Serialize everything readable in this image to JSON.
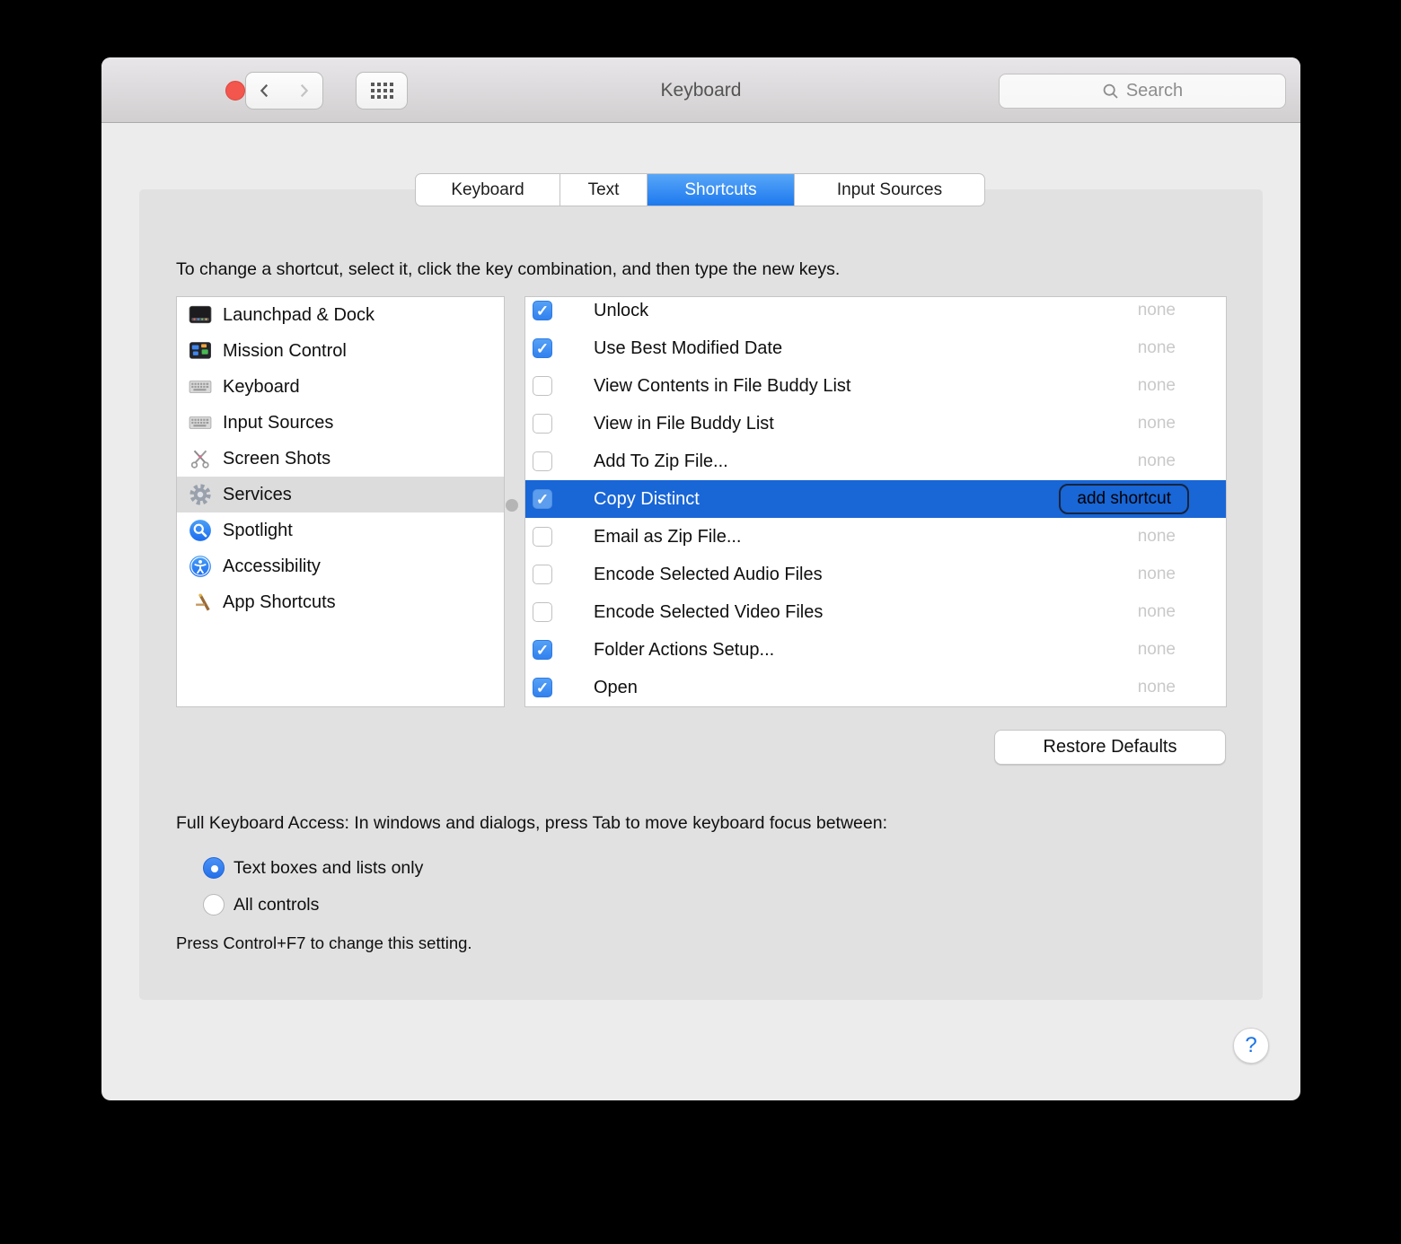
{
  "titlebar": {
    "title": "Keyboard",
    "search": {
      "placeholder": "Search"
    }
  },
  "tabs": {
    "items": [
      {
        "label": "Keyboard",
        "selected": false
      },
      {
        "label": "Text",
        "selected": false
      },
      {
        "label": "Shortcuts",
        "selected": true
      },
      {
        "label": "Input Sources",
        "selected": false
      }
    ]
  },
  "instruction": "To change a shortcut, select it, click the key combination, and then type the new keys.",
  "sidebar": {
    "items": [
      {
        "label": "Launchpad & Dock",
        "icon": "launchpad-dock-icon",
        "selected": false
      },
      {
        "label": "Mission Control",
        "icon": "mission-control-icon",
        "selected": false
      },
      {
        "label": "Keyboard",
        "icon": "keyboard-icon",
        "selected": false
      },
      {
        "label": "Input Sources",
        "icon": "input-sources-icon",
        "selected": false
      },
      {
        "label": "Screen Shots",
        "icon": "screen-shots-icon",
        "selected": false
      },
      {
        "label": "Services",
        "icon": "services-gear-icon",
        "selected": true
      },
      {
        "label": "Spotlight",
        "icon": "spotlight-icon",
        "selected": false
      },
      {
        "label": "Accessibility",
        "icon": "accessibility-icon",
        "selected": false
      },
      {
        "label": "App Shortcuts",
        "icon": "app-shortcuts-icon",
        "selected": false
      }
    ]
  },
  "services": {
    "rows": [
      {
        "label": "Unlock",
        "checked": true,
        "shortcut": "none",
        "selected": false
      },
      {
        "label": "Use Best Modified Date",
        "checked": true,
        "shortcut": "none",
        "selected": false
      },
      {
        "label": "View Contents in File Buddy List",
        "checked": false,
        "shortcut": "none",
        "selected": false
      },
      {
        "label": "View in File Buddy List",
        "checked": false,
        "shortcut": "none",
        "selected": false
      },
      {
        "label": "Add To Zip File...",
        "checked": false,
        "shortcut": "none",
        "selected": false
      },
      {
        "label": "Copy Distinct",
        "checked": true,
        "shortcut": "",
        "selected": true,
        "button_label": "add shortcut"
      },
      {
        "label": "Email as Zip File...",
        "checked": false,
        "shortcut": "none",
        "selected": false
      },
      {
        "label": "Encode Selected Audio Files",
        "checked": false,
        "shortcut": "none",
        "selected": false
      },
      {
        "label": "Encode Selected Video Files",
        "checked": false,
        "shortcut": "none",
        "selected": false
      },
      {
        "label": "Folder Actions Setup...",
        "checked": true,
        "shortcut": "none",
        "selected": false
      },
      {
        "label": "Open",
        "checked": true,
        "shortcut": "none",
        "selected": false
      }
    ]
  },
  "buttons": {
    "restore_defaults": "Restore Defaults"
  },
  "full_keyboard_access": {
    "heading": "Full Keyboard Access: In windows and dialogs, press Tab to move keyboard focus between:",
    "options": [
      {
        "label": "Text boxes and lists only",
        "selected": true
      },
      {
        "label": "All controls",
        "selected": false
      }
    ],
    "note": "Press Control+F7 to change this setting."
  },
  "help": {
    "label": "?"
  },
  "colors": {
    "selection_blue": "#1966d6",
    "checkbox_blue": "#3c8bf0",
    "tab_selected_blue": "#1d79ee",
    "none_gray": "#c9c9c9",
    "sidebar_selected_gray": "#dcdcdc"
  }
}
